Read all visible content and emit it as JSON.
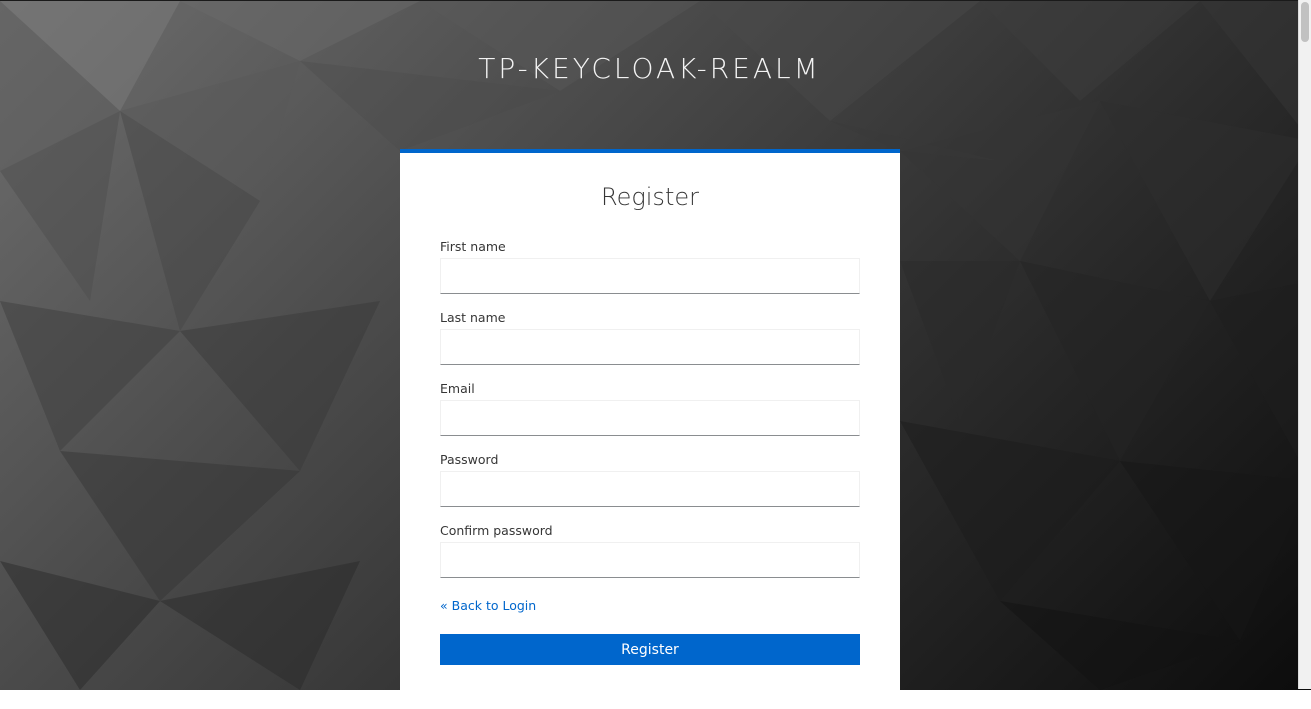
{
  "realm": {
    "title": "TP-KEYCLOAK-REALM"
  },
  "form": {
    "title": "Register",
    "fields": [
      {
        "label": "First name",
        "value": "",
        "placeholder": ""
      },
      {
        "label": "Last name",
        "value": "",
        "placeholder": ""
      },
      {
        "label": "Email",
        "value": "",
        "placeholder": ""
      },
      {
        "label": "Password",
        "value": "",
        "placeholder": ""
      },
      {
        "label": "Confirm password",
        "value": "",
        "placeholder": ""
      }
    ],
    "back_link": "« Back to Login",
    "submit_label": "Register"
  },
  "colors": {
    "accent": "#0066cc",
    "card_background": "#ffffff",
    "title_text": "#f3f3f3"
  }
}
